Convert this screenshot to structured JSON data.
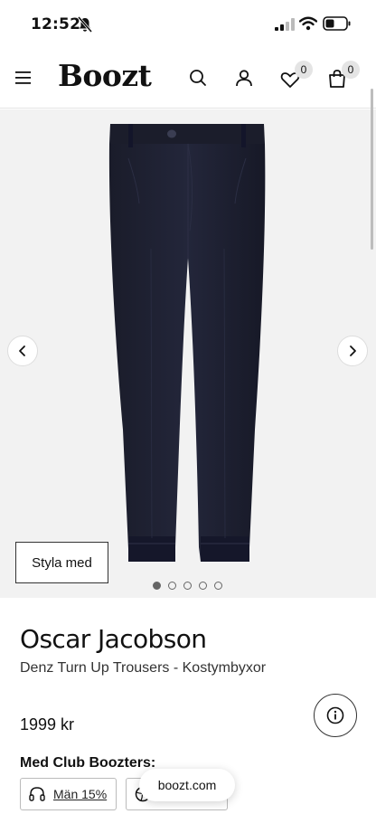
{
  "status_bar": {
    "time": "12:52"
  },
  "header": {
    "logo": "Boozt",
    "wishlist_count": "0",
    "bag_count": "0"
  },
  "gallery": {
    "styla_label": "Styla med",
    "dot_count": 5,
    "active_dot": 0
  },
  "product": {
    "brand": "Oscar Jacobson",
    "name": "Denz Turn Up Trousers - Kostymbyxor",
    "price": "1999 kr",
    "club_heading": "Med Club Boozters:",
    "discounts": [
      {
        "label": "Män 15%"
      },
      {
        "label": ""
      }
    ]
  },
  "browser": {
    "url": "boozt.com"
  }
}
